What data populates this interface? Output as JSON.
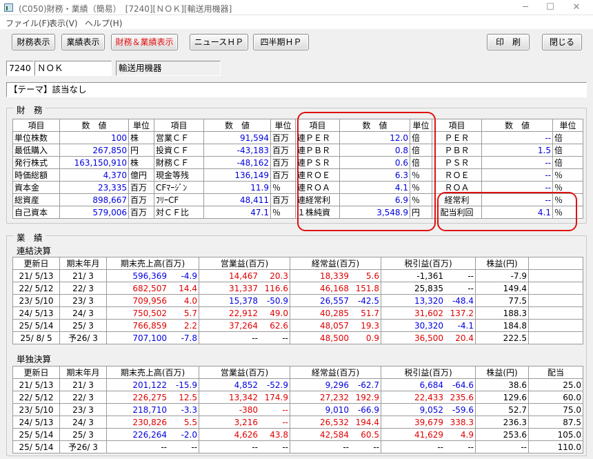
{
  "window": {
    "title": "(C050)財務・業績（簡易）　[7240][ＮＯＫ][輸送用機器]",
    "minimize": "─",
    "maximize": "☐",
    "close": "✕",
    "icon": "app-icon"
  },
  "menu": [
    "ファイル(F)",
    "表示(V)",
    "ヘルプ(H)"
  ],
  "toolbar": {
    "zaimu": "財務表示",
    "gyoseki": "業績表示",
    "both": "財務＆業績表示",
    "news": "ニュースＨＰ",
    "shihanki": "四半期ＨＰ",
    "print": "印　刷",
    "close": "閉じる"
  },
  "company": {
    "code": "7240",
    "name": "ＮＯＫ",
    "industry": "輸送用機器"
  },
  "theme": "【テーマ】該当なし",
  "zaimu": {
    "label": "財　務",
    "headers": [
      "項目",
      "数　値",
      "単位",
      "項目",
      "数　値",
      "単位",
      "項目",
      "数　値",
      "単位",
      "項目",
      "数　値",
      "単位"
    ],
    "rows": [
      [
        "単位株数",
        "100",
        "株",
        "営業ＣＦ",
        "91,594",
        "百万",
        "連ＰＥＲ",
        "12.0",
        "倍",
        "ＰＥＲ",
        "--",
        "倍"
      ],
      [
        "最低購入",
        "267,850",
        "円",
        "投資ＣＦ",
        "-43,183",
        "百万",
        "連ＰＢＲ",
        "0.8",
        "倍",
        "ＰＢＲ",
        "1.5",
        "倍"
      ],
      [
        "発行株式",
        "163,150,910",
        "株",
        "財務ＣＦ",
        "-48,162",
        "百万",
        "連ＰＳＲ",
        "0.6",
        "倍",
        "ＰＳＲ",
        "--",
        "倍"
      ],
      [
        "時価総額",
        "4,370",
        "億円",
        "現金等残",
        "136,149",
        "百万",
        "連ＲＯＥ",
        "6.3",
        "％",
        "ＲＯＥ",
        "--",
        "％"
      ],
      [
        "資本金",
        "23,335",
        "百万",
        "CFﾏｰｼﾞﾝ",
        "11.9",
        "％",
        "連ＲＯＡ",
        "4.1",
        "％",
        "ＲＯＡ",
        "--",
        "％"
      ],
      [
        "総資産",
        "898,667",
        "百万",
        "ﾌﾘｰCF",
        "48,411",
        "百万",
        "連経常利",
        "6.9",
        "％",
        "経常利",
        "--",
        "％"
      ],
      [
        "自己資本",
        "579,006",
        "百万",
        "対ＣＦ比",
        "47.1",
        "％",
        "１株純資",
        "3,548.9",
        "円",
        "配当利回",
        "4.1",
        "％"
      ]
    ]
  },
  "gyoseki": {
    "label": "業　績",
    "renketsu": {
      "label": "連結決算",
      "headers": [
        "更新日",
        "期末年月",
        "期末売上高(百万)",
        "営業益(百万)",
        "経常益(百万)",
        "税引益(百万)",
        "株益(円)"
      ],
      "rows": [
        [
          "21/ 5/13",
          "21/ 3",
          "596,369",
          "-4.9",
          "14,467",
          "20.3",
          "18,339",
          "5.6",
          "-1,361",
          "--",
          "-7.9"
        ],
        [
          "22/ 5/12",
          "22/ 3",
          "682,507",
          "14.4",
          "31,337",
          "116.6",
          "46,168",
          "151.8",
          "25,835",
          "--",
          "149.4"
        ],
        [
          "23/ 5/10",
          "23/ 3",
          "709,956",
          "4.0",
          "15,378",
          "-50.9",
          "26,557",
          "-42.5",
          "13,320",
          "-48.4",
          "77.5"
        ],
        [
          "24/ 5/13",
          "24/ 3",
          "750,502",
          "5.7",
          "22,912",
          "49.0",
          "40,285",
          "51.7",
          "31,602",
          "137.2",
          "188.3"
        ],
        [
          "25/ 5/14",
          "25/ 3",
          "766,859",
          "2.2",
          "37,264",
          "62.6",
          "48,057",
          "19.3",
          "30,320",
          "-4.1",
          "184.8"
        ],
        [
          "25/ 8/ 5",
          "予26/ 3",
          "707,100",
          "-7.8",
          "--",
          "--",
          "48,500",
          "0.9",
          "36,500",
          "20.4",
          "222.5"
        ]
      ]
    },
    "tandoku": {
      "label": "単独決算",
      "headers": [
        "更新日",
        "期末年月",
        "期末売上高(百万)",
        "営業益(百万)",
        "経常益(百万)",
        "税引益(百万)",
        "株益(円)",
        "配当"
      ],
      "rows": [
        [
          "21/ 5/13",
          "21/ 3",
          "201,122",
          "-15.9",
          "4,852",
          "-52.9",
          "9,296",
          "-62.7",
          "6,684",
          "-64.6",
          "38.6",
          "25.0"
        ],
        [
          "22/ 5/12",
          "22/ 3",
          "226,275",
          "12.5",
          "13,342",
          "174.9",
          "27,232",
          "192.9",
          "22,433",
          "235.6",
          "129.6",
          "60.0"
        ],
        [
          "23/ 5/10",
          "23/ 3",
          "218,710",
          "-3.3",
          "-380",
          "--",
          "9,010",
          "-66.9",
          "9,052",
          "-59.6",
          "52.7",
          "75.0"
        ],
        [
          "24/ 5/13",
          "24/ 3",
          "230,826",
          "5.5",
          "3,216",
          "--",
          "26,532",
          "194.4",
          "39,679",
          "338.3",
          "236.3",
          "87.5"
        ],
        [
          "25/ 5/14",
          "25/ 3",
          "226,264",
          "-2.0",
          "4,626",
          "43.8",
          "42,584",
          "60.5",
          "41,629",
          "4.9",
          "253.6",
          "105.0"
        ],
        [
          "25/ 5/14",
          "予26/ 3",
          "--",
          "--",
          "--",
          "--",
          "--",
          "--",
          "--",
          "--",
          "--",
          "110.0"
        ]
      ]
    }
  },
  "colors": {
    "red": "#e00000",
    "blue": "#0000e0",
    "highlight": "#e01010"
  }
}
